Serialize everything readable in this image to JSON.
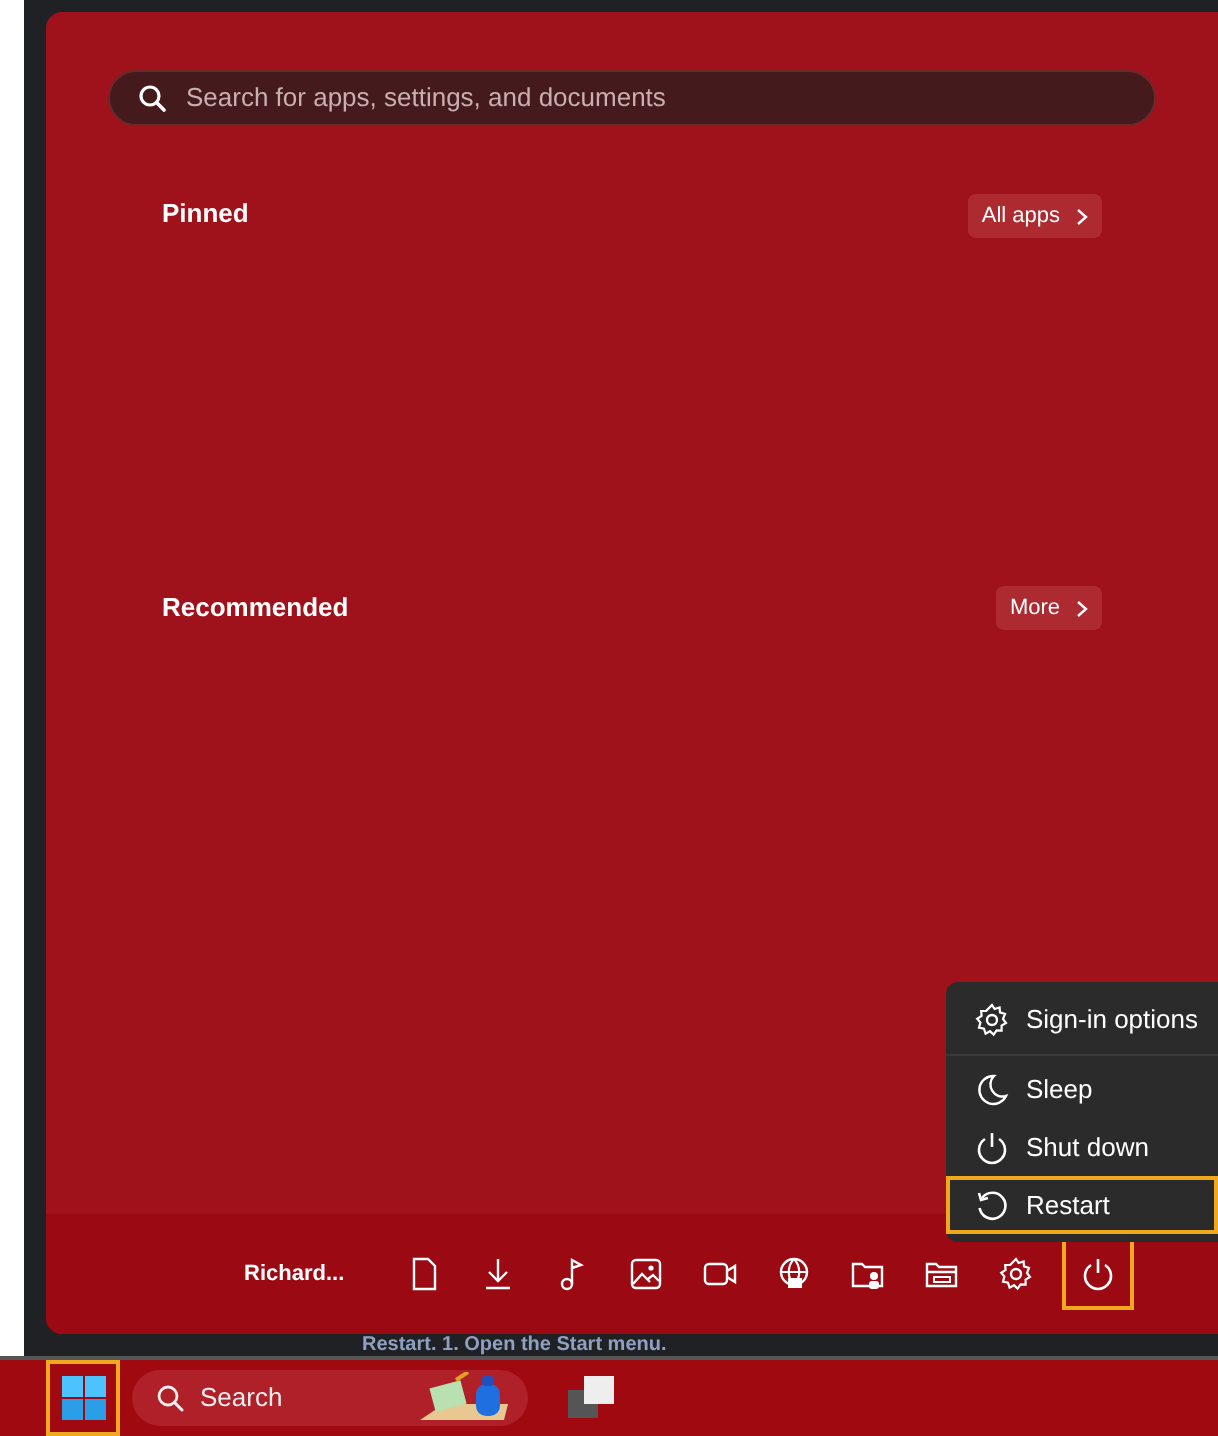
{
  "search": {
    "placeholder": "Search for apps, settings, and documents"
  },
  "sections": [
    {
      "title": "Pinned",
      "button": "All apps"
    },
    {
      "title": "Recommended",
      "button": "More"
    }
  ],
  "power_menu": [
    {
      "label": "Sign-in options",
      "kind": "gear",
      "highlighted": false
    },
    {
      "label": "Sleep",
      "kind": "moon",
      "highlighted": false
    },
    {
      "label": "Shut down",
      "kind": "power",
      "highlighted": false
    },
    {
      "label": "Restart",
      "kind": "restart",
      "highlighted": true
    }
  ],
  "user": {
    "name": "Richard..."
  },
  "folders": [
    {
      "kind": "document"
    },
    {
      "kind": "download"
    },
    {
      "kind": "music"
    },
    {
      "kind": "image"
    },
    {
      "kind": "video"
    },
    {
      "kind": "network"
    },
    {
      "kind": "user-folder"
    },
    {
      "kind": "folder"
    },
    {
      "kind": "gear"
    }
  ],
  "power_button": {
    "highlighted": true
  },
  "caption": "Restart. 1. Open the Start menu.",
  "taskbar": {
    "start_highlighted": true,
    "search_placeholder": "Search"
  }
}
